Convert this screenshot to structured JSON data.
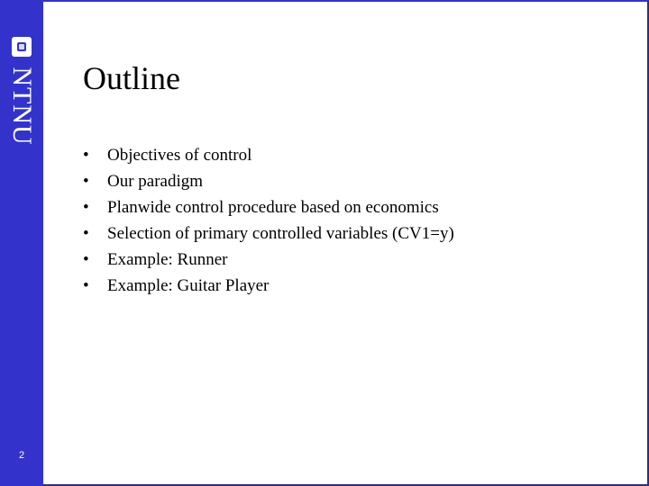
{
  "slide": {
    "title": "Outline",
    "page_number": "2",
    "logo_text": "NTNU",
    "bullet_glyph": "•",
    "bullets": [
      "Objectives of control",
      "Our paradigm",
      "Planwide control procedure based on economics",
      "Selection of primary controlled variables (CV1=y)",
      "Example: Runner",
      "Example: Guitar Player"
    ]
  },
  "colors": {
    "sidebar": "#3333cc",
    "border": "#2e2e80"
  }
}
